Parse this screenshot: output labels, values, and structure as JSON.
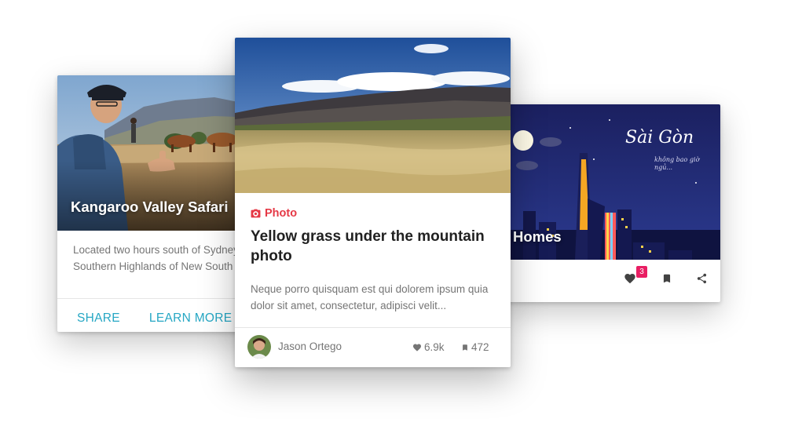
{
  "colors": {
    "accent_teal": "#26a7c4",
    "category_red": "#e53946",
    "badge_pink": "#e91e63",
    "text_primary": "#212121",
    "text_secondary": "#757575"
  },
  "left_card": {
    "title": "Kangaroo Valley Safari",
    "body_line_1": "Located two hours south of Sydney in the",
    "body_line_2": "Southern Highlands of New South Wales,",
    "share_label": "SHARE",
    "learn_more_label": "LEARN MORE"
  },
  "center_card": {
    "category_icon": "camera-icon",
    "category": "Photo",
    "title": "Yellow grass under the mountain photo",
    "excerpt": "Neque porro quisquam est qui dolorem ipsum quia dolor sit amet, consectetur, adipisci velit...",
    "author": "Jason Ortego",
    "likes": "6.9k",
    "bookmarks": "472"
  },
  "right_card": {
    "script_title": "Sài Gòn",
    "script_subtitle": "không bao giờ ngủ...",
    "title": "Homes",
    "like_count": "3",
    "icons": [
      "heart-icon",
      "bookmark-icon",
      "share-icon"
    ]
  }
}
